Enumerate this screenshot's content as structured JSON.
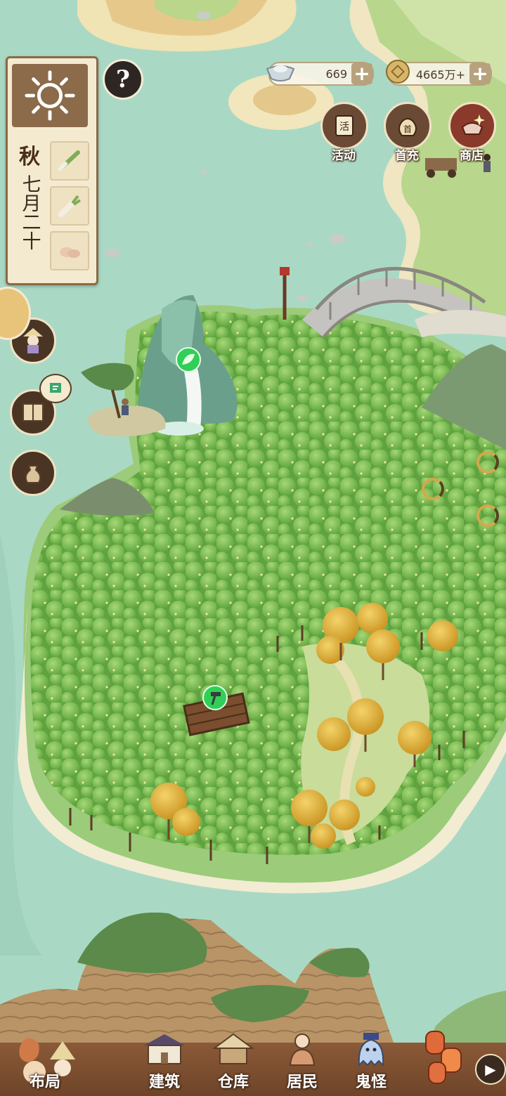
{
  "season": {
    "name": "秋",
    "date": "七月二十"
  },
  "help": {
    "symbol": "?"
  },
  "currency": {
    "silver": {
      "value": "669",
      "icon": "silver-ingot-icon"
    },
    "coins": {
      "value": "4665万+",
      "icon": "copper-coin-icon"
    }
  },
  "features": [
    {
      "label": "活动",
      "icon": "calendar-scroll-icon"
    },
    {
      "label": "首充",
      "icon": "money-bag-icon"
    },
    {
      "label": "商店",
      "icon": "shop-bag-icon"
    }
  ],
  "bottom_nav": {
    "layout": "布局",
    "items": [
      {
        "label": "建筑",
        "icon": "building-icon"
      },
      {
        "label": "仓库",
        "icon": "warehouse-icon"
      },
      {
        "label": "居民",
        "icon": "resident-icon"
      },
      {
        "label": "鬼怪",
        "icon": "ghost-icon"
      }
    ],
    "more": "▶"
  },
  "colors": {
    "water": "#a9d9c4",
    "grass": "#9ccb7a",
    "forest": "#6fb548",
    "autumn": "#e0b13a",
    "panel": "#f4ead0",
    "wood": "#7a4e2e"
  }
}
